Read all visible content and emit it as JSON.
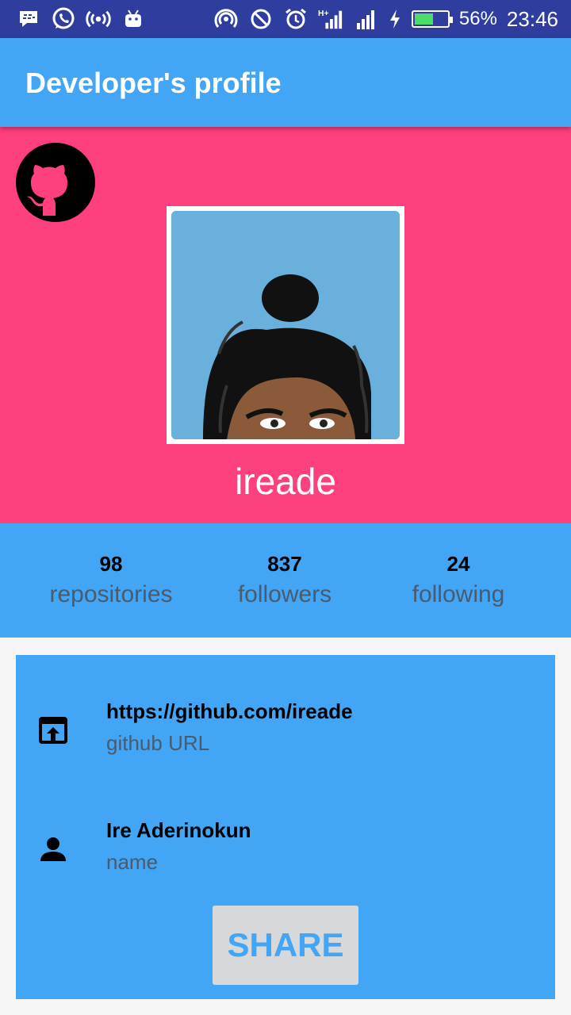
{
  "status_bar": {
    "battery_percent": "56%",
    "battery_level": 0.56,
    "time": "23:46",
    "icons": [
      "bbm-icon",
      "whatsapp-icon",
      "radio-broadcast-icon",
      "android-icon",
      "hotspot-icon",
      "do-not-disturb-icon",
      "alarm-icon",
      "signal-hplus-icon",
      "signal-icon",
      "charging-icon",
      "battery-icon"
    ]
  },
  "app_bar": {
    "title": "Developer's profile"
  },
  "profile": {
    "username": "ireade",
    "avatar_bg": "#6ab0dd",
    "hero_color": "#ff407e"
  },
  "stats": {
    "repositories": {
      "value": "98",
      "label": "repositories"
    },
    "followers": {
      "value": "837",
      "label": "followers"
    },
    "following": {
      "value": "24",
      "label": "following"
    }
  },
  "info": {
    "github": {
      "value": "https://github.com/ireade",
      "label": "github URL",
      "icon": "open-in-browser-icon"
    },
    "name": {
      "value": "Ire Aderinokun",
      "label": "name",
      "icon": "person-icon"
    }
  },
  "share_button": {
    "label": "SHARE"
  },
  "colors": {
    "primary": "#42a5f5",
    "status_bar": "#2f3e9e",
    "accent": "#ff407e"
  }
}
